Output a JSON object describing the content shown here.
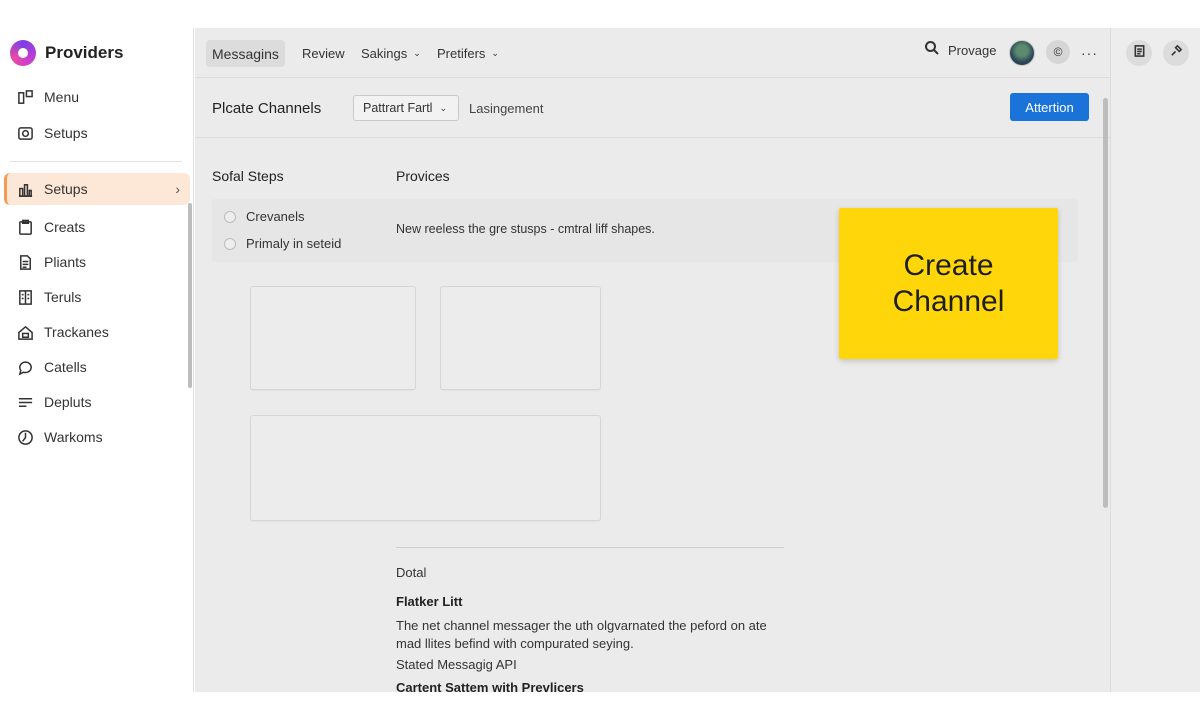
{
  "sidebar": {
    "brand_title": "Providers",
    "items": [
      {
        "label": "Menu",
        "icon": "grid-icon"
      },
      {
        "label": "Setups",
        "icon": "frame-icon"
      },
      {
        "label": "Setups",
        "icon": "bar-chart-icon",
        "active": true
      },
      {
        "label": "Creats",
        "icon": "clipboard-icon"
      },
      {
        "label": "Pliants",
        "icon": "document-icon"
      },
      {
        "label": "Teruls",
        "icon": "book-icon"
      },
      {
        "label": "Trackanes",
        "icon": "home-icon"
      },
      {
        "label": "Catells",
        "icon": "chat-bubble-icon"
      },
      {
        "label": "Depluts",
        "icon": "list-icon"
      },
      {
        "label": "Warkoms",
        "icon": "clock-icon"
      }
    ],
    "active_chevron": "›"
  },
  "topbar": {
    "tabs": [
      {
        "label": "Messagins",
        "selected": true,
        "dropdown": false
      },
      {
        "label": "Review",
        "selected": false,
        "dropdown": false
      },
      {
        "label": "Sakings",
        "selected": false,
        "dropdown": true
      },
      {
        "label": "Pretifers",
        "selected": false,
        "dropdown": true
      }
    ],
    "dropdown_glyph": "⌄",
    "search_label": "Provage",
    "circle_button_glyph": "©",
    "more_glyph": "···"
  },
  "header": {
    "title": "Plcate Channels",
    "select_value": "Pattrart Fartl",
    "breadcrumb": "Lasingement",
    "primary_button": "Attertion"
  },
  "sections": {
    "left_heading": "Sofal Steps",
    "right_heading": "Provices"
  },
  "options": [
    {
      "label": "Crevanels"
    },
    {
      "label": "Primaly in seteid"
    }
  ],
  "options_description": "New reeless the gre stusps - cmtral liff shapes.",
  "callout": {
    "text": "Create Channel",
    "color": "#ffd60a"
  },
  "details": {
    "label": "Dotal",
    "heading": "Flatker Litt",
    "paragraph": "The net channel messager the uth olgvarnated the peford on ate mad llites befind with compurated seying.",
    "line1": "Stated Messagig API",
    "line2": "Cartent Sattem with Prevlicers"
  },
  "colors": {
    "accent": "#1a73d9",
    "active_item_bg": "#fde8d8",
    "active_item_border": "#f39a55"
  }
}
